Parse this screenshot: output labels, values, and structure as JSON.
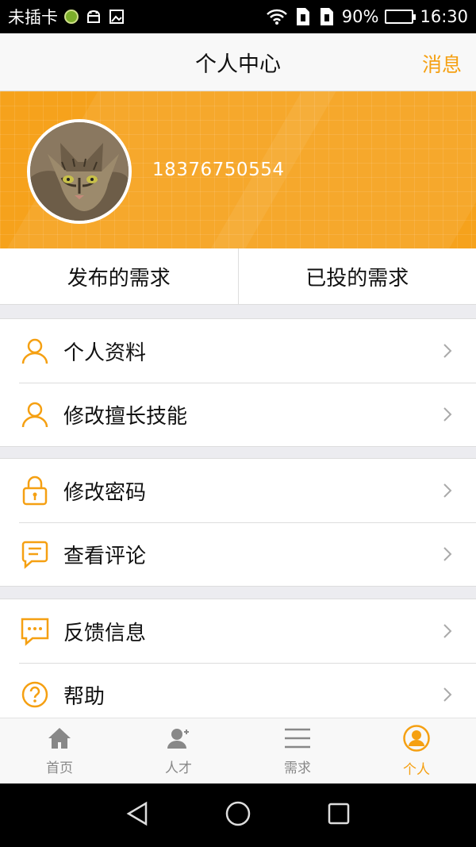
{
  "status_bar": {
    "carrier": "未插卡",
    "battery_text": "90%",
    "battery_level": 0.9,
    "time": "16:30"
  },
  "header": {
    "title": "个人中心",
    "message_label": "消息"
  },
  "profile": {
    "phone": "18376750554"
  },
  "tabs": [
    {
      "label": "发布的需求"
    },
    {
      "label": "已投的需求"
    }
  ],
  "menu": {
    "group1": [
      {
        "label": "个人资料",
        "icon": "person-icon"
      },
      {
        "label": "修改擅长技能",
        "icon": "person-icon"
      }
    ],
    "group2": [
      {
        "label": "修改密码",
        "icon": "lock-icon"
      },
      {
        "label": "查看评论",
        "icon": "comment-icon"
      }
    ],
    "group3": [
      {
        "label": "反馈信息",
        "icon": "chat-bubble-icon"
      },
      {
        "label": "帮助",
        "icon": "question-icon"
      }
    ]
  },
  "bottom_nav": [
    {
      "label": "首页",
      "icon": "home-icon",
      "active": false
    },
    {
      "label": "人才",
      "icon": "talent-icon",
      "active": false
    },
    {
      "label": "需求",
      "icon": "list-icon",
      "active": false
    },
    {
      "label": "个人",
      "icon": "profile-icon",
      "active": true
    }
  ],
  "colors": {
    "accent": "#f5a012",
    "banner": "#f6a21c",
    "inactive": "#888888"
  }
}
